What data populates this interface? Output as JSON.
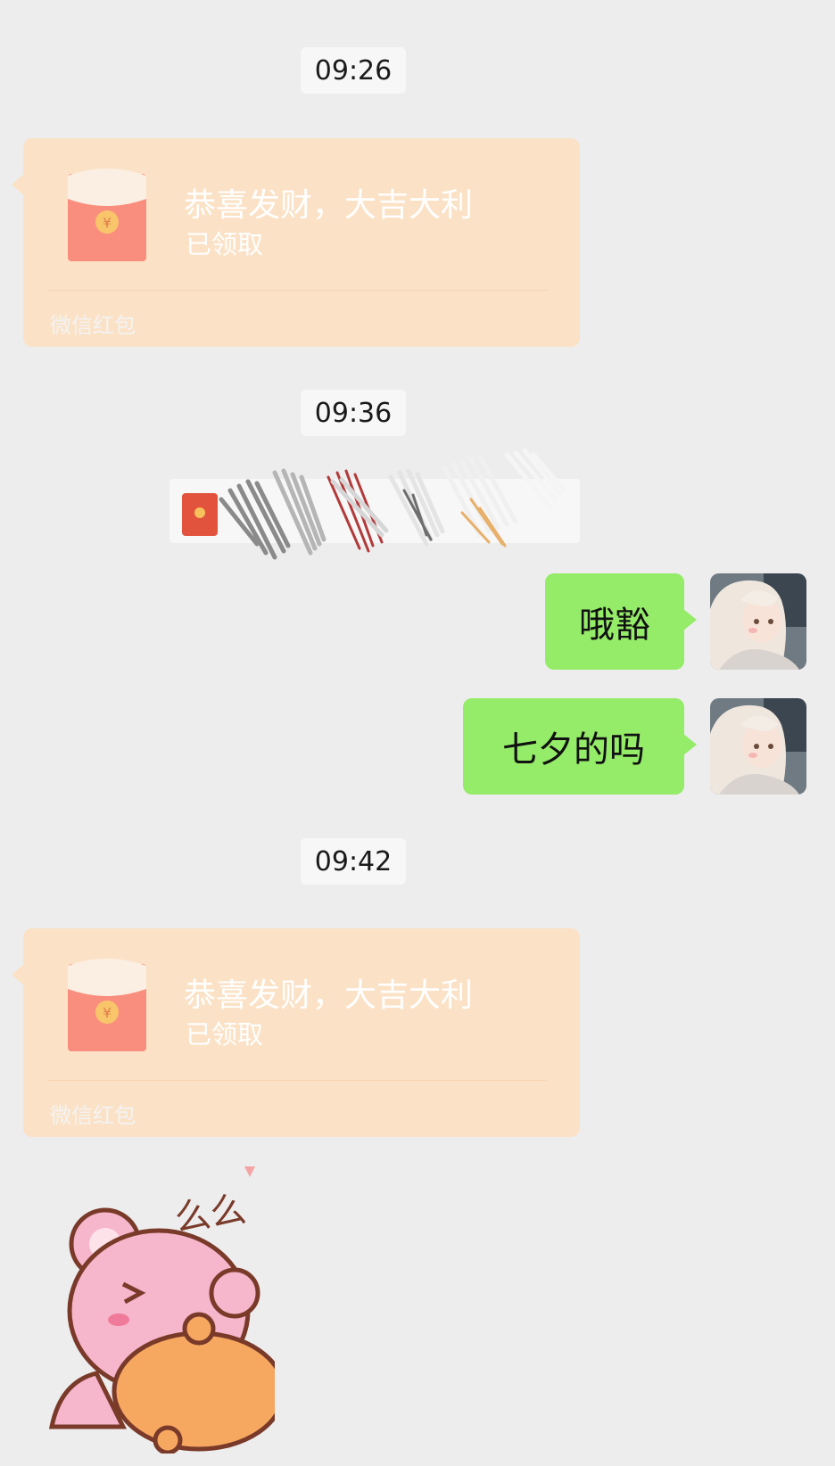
{
  "chat": {
    "timestamps": [
      "09:26",
      "09:36",
      "09:42"
    ],
    "red_packets": [
      {
        "title": "恭喜发财，大吉大利",
        "status": "已领取",
        "footer": "微信红包"
      },
      {
        "title": "恭喜发财，大吉大利",
        "status": "已领取",
        "footer": "微信红包"
      }
    ],
    "notice": {
      "icon": "red-packet-icon",
      "text": ""
    },
    "messages": [
      {
        "text": "哦豁",
        "side": "right"
      },
      {
        "text": "七夕的吗",
        "side": "right"
      }
    ],
    "sticker": {
      "text": "么么"
    }
  },
  "colors": {
    "background": "#ededed",
    "sent_bubble": "#95ec69",
    "red_packet": "#fbe2c6",
    "red_packet_icon": "#f98e7e"
  }
}
